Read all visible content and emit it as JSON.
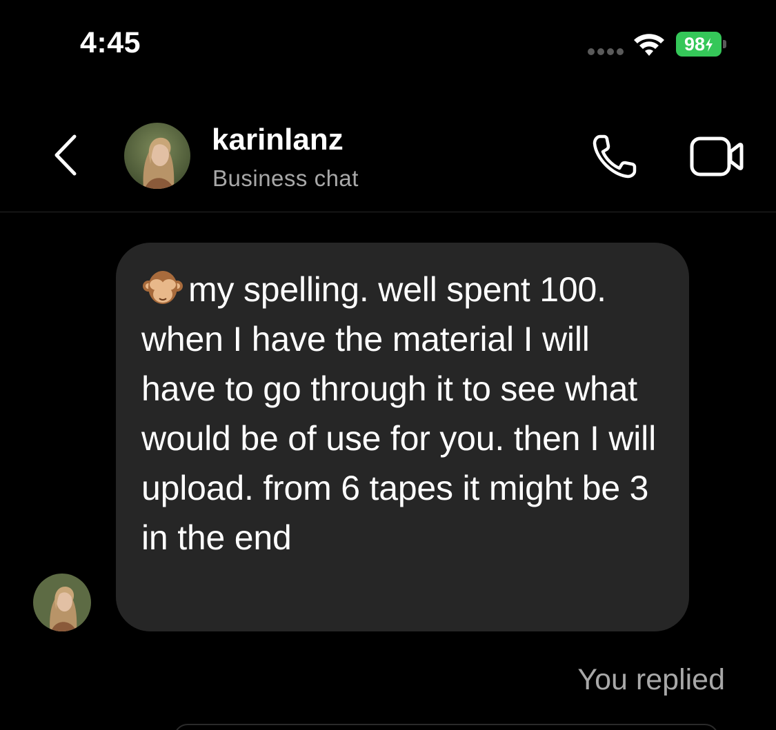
{
  "status_bar": {
    "time": "4:45",
    "battery_level": "98",
    "battery_color": "#35c759"
  },
  "header": {
    "back_icon": "chevron-left-icon",
    "name": "karinlanz",
    "subtitle": "Business chat",
    "call_icon": "phone-icon",
    "video_icon": "video-camera-icon"
  },
  "messages": [
    {
      "sender": "karinlanz",
      "emoji": "see-no-evil-monkey-icon",
      "text": "my spelling. well spent 100. when I have the material I will have to go through it to see what would be of use for you. then I will upload. from 6 tapes it might be 3 in the end"
    }
  ],
  "footer": {
    "replied_label": "You replied"
  },
  "colors": {
    "background": "#000000",
    "bubble": "#262626",
    "secondary_text": "#a8a8a8"
  }
}
